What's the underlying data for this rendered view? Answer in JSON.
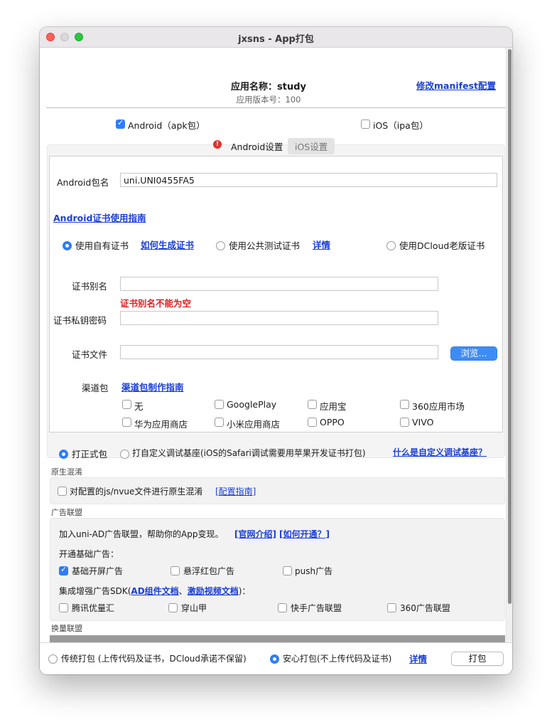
{
  "window": {
    "title": "jxsns - App打包"
  },
  "header": {
    "app_name": "应用名称：study",
    "version": "应用版本号：100",
    "manifest_link": "修改manifest配置"
  },
  "platforms": {
    "android": {
      "label": "Android（apk包）",
      "checked": true
    },
    "ios": {
      "label": "iOS（ipa包）",
      "checked": false
    }
  },
  "tabs": {
    "android": "Android设置",
    "ios": "iOS设置"
  },
  "android": {
    "package_label": "Android包名",
    "package_value": "uni.UNI0455FA5",
    "cert_guide_link": "Android证书使用指南",
    "cert_options": [
      {
        "label": "使用自有证书",
        "checked": true
      },
      {
        "label": "使用公共测试证书",
        "checked": false
      },
      {
        "label": "使用DCloud老版证书",
        "checked": false
      }
    ],
    "how_generate_link": "如何生成证书",
    "details_link": "详情",
    "alias_label": "证书别名",
    "alias_value": "",
    "alias_error": "证书别名不能为空",
    "password_label": "证书私钥密码",
    "password_value": "",
    "file_label": "证书文件",
    "file_value": "",
    "browse_button": "浏览...",
    "channel_label": "渠道包",
    "channel_guide_link": "渠道包制作指南",
    "channels": [
      {
        "label": "无",
        "checked": false
      },
      {
        "label": "GooglePlay",
        "checked": false
      },
      {
        "label": "应用宝",
        "checked": false
      },
      {
        "label": "360应用市场",
        "checked": false
      },
      {
        "label": "华为应用商店",
        "checked": false
      },
      {
        "label": "小米应用商店",
        "checked": false
      },
      {
        "label": "OPPO",
        "checked": false
      },
      {
        "label": "VIVO",
        "checked": false
      }
    ]
  },
  "build_type": {
    "formal": {
      "label": "打正式包",
      "checked": true
    },
    "custom": {
      "label": "打自定义调试基座(iOS的Safari调试需要用苹果开发证书打包)",
      "checked": false
    },
    "what_link": "什么是自定义调试基座？"
  },
  "obfuscation": {
    "section_label": "原生混淆",
    "checkbox_label": "对配置的js/nvue文件进行原生混淆",
    "guide_link": "[配置指南]"
  },
  "ads": {
    "section_label": "广告联盟",
    "intro_text": "加入uni-AD广告联盟，帮助你的App变现。",
    "site_link": "[官网介绍]",
    "how_link": "[如何开通？]",
    "basic_title": "开通基础广告：",
    "basic_options": [
      {
        "label": "基础开屏广告",
        "checked": true
      },
      {
        "label": "悬浮红包广告",
        "checked": false
      },
      {
        "label": "push广告",
        "checked": false
      }
    ],
    "sdk_title_prefix": "集成增强广告SDK(",
    "sdk_doc_link": "AD组件文档",
    "sdk_sep": "、",
    "sdk_video_link": "激励视频文档",
    "sdk_title_suffix": ")：",
    "sdk_options": [
      {
        "label": "腾讯优量汇",
        "checked": false
      },
      {
        "label": "穿山甲",
        "checked": false
      },
      {
        "label": "快手广告联盟",
        "checked": false
      },
      {
        "label": "360广告联盟",
        "checked": false
      }
    ]
  },
  "exchange": {
    "section_label": "换量联盟"
  },
  "footer": {
    "traditional": {
      "label": "传统打包 (上传代码及证书，DCloud承诺不保留)",
      "checked": false
    },
    "safe": {
      "label": "安心打包(不上传代码及证书)",
      "checked": true
    },
    "details_link": "详情",
    "pack_button": "打包"
  },
  "colors": {
    "accent": "#2f7cf6",
    "link": "#1a3fd6",
    "error": "#e02020"
  }
}
